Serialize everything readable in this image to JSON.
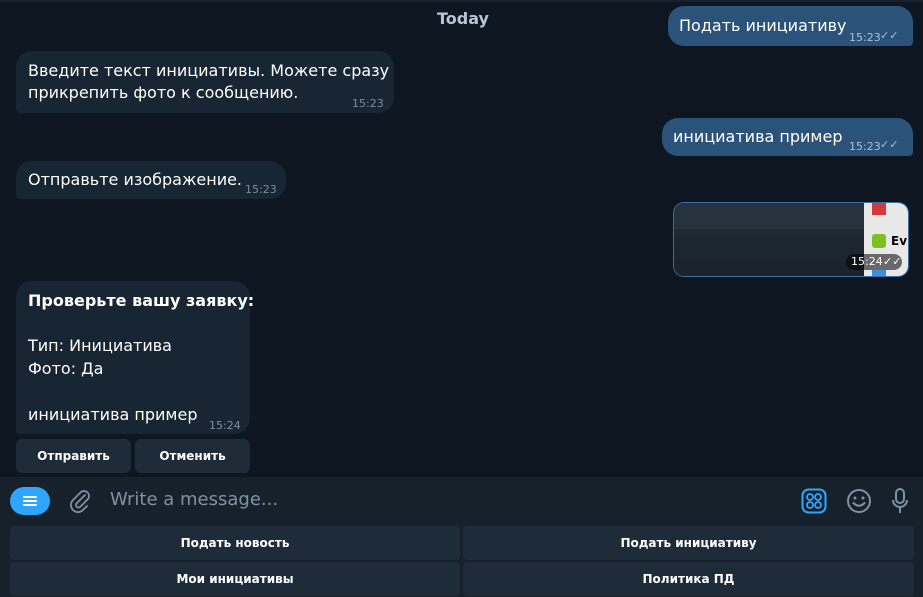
{
  "chat": {
    "date_label": "Today",
    "messages": [
      {
        "text": "Подать инициативу",
        "time": "15:23"
      },
      {
        "text": "Введите текст инициативы. Можете сразу прикрепить фото к сообщению.",
        "time": "15:23"
      },
      {
        "text": "инициатива пример",
        "time": "15:23"
      },
      {
        "text": "Отправьте изображение.",
        "time": "15:23"
      },
      {
        "time": "15:24",
        "image_fragment_text": "Ev"
      },
      {
        "title": "Проверьте вашу заявку:",
        "line_type": "Тип: Инициатива",
        "line_photo": "Фото: Да",
        "line_text": "инициатива пример",
        "time": "15:24"
      }
    ],
    "inline_buttons": {
      "send": "Отправить",
      "cancel": "Отменить"
    }
  },
  "composer": {
    "placeholder": "Write a message...",
    "icons": [
      "menu-icon",
      "paperclip-icon",
      "bot-commands-icon",
      "emoji-icon",
      "microphone-icon"
    ],
    "accent": "#2ea6ff"
  },
  "reply_keyboard": {
    "row1": [
      "Подать новость",
      "Подать инициативу"
    ],
    "row2": [
      "Мои инициативы",
      "Политика ПД"
    ]
  }
}
